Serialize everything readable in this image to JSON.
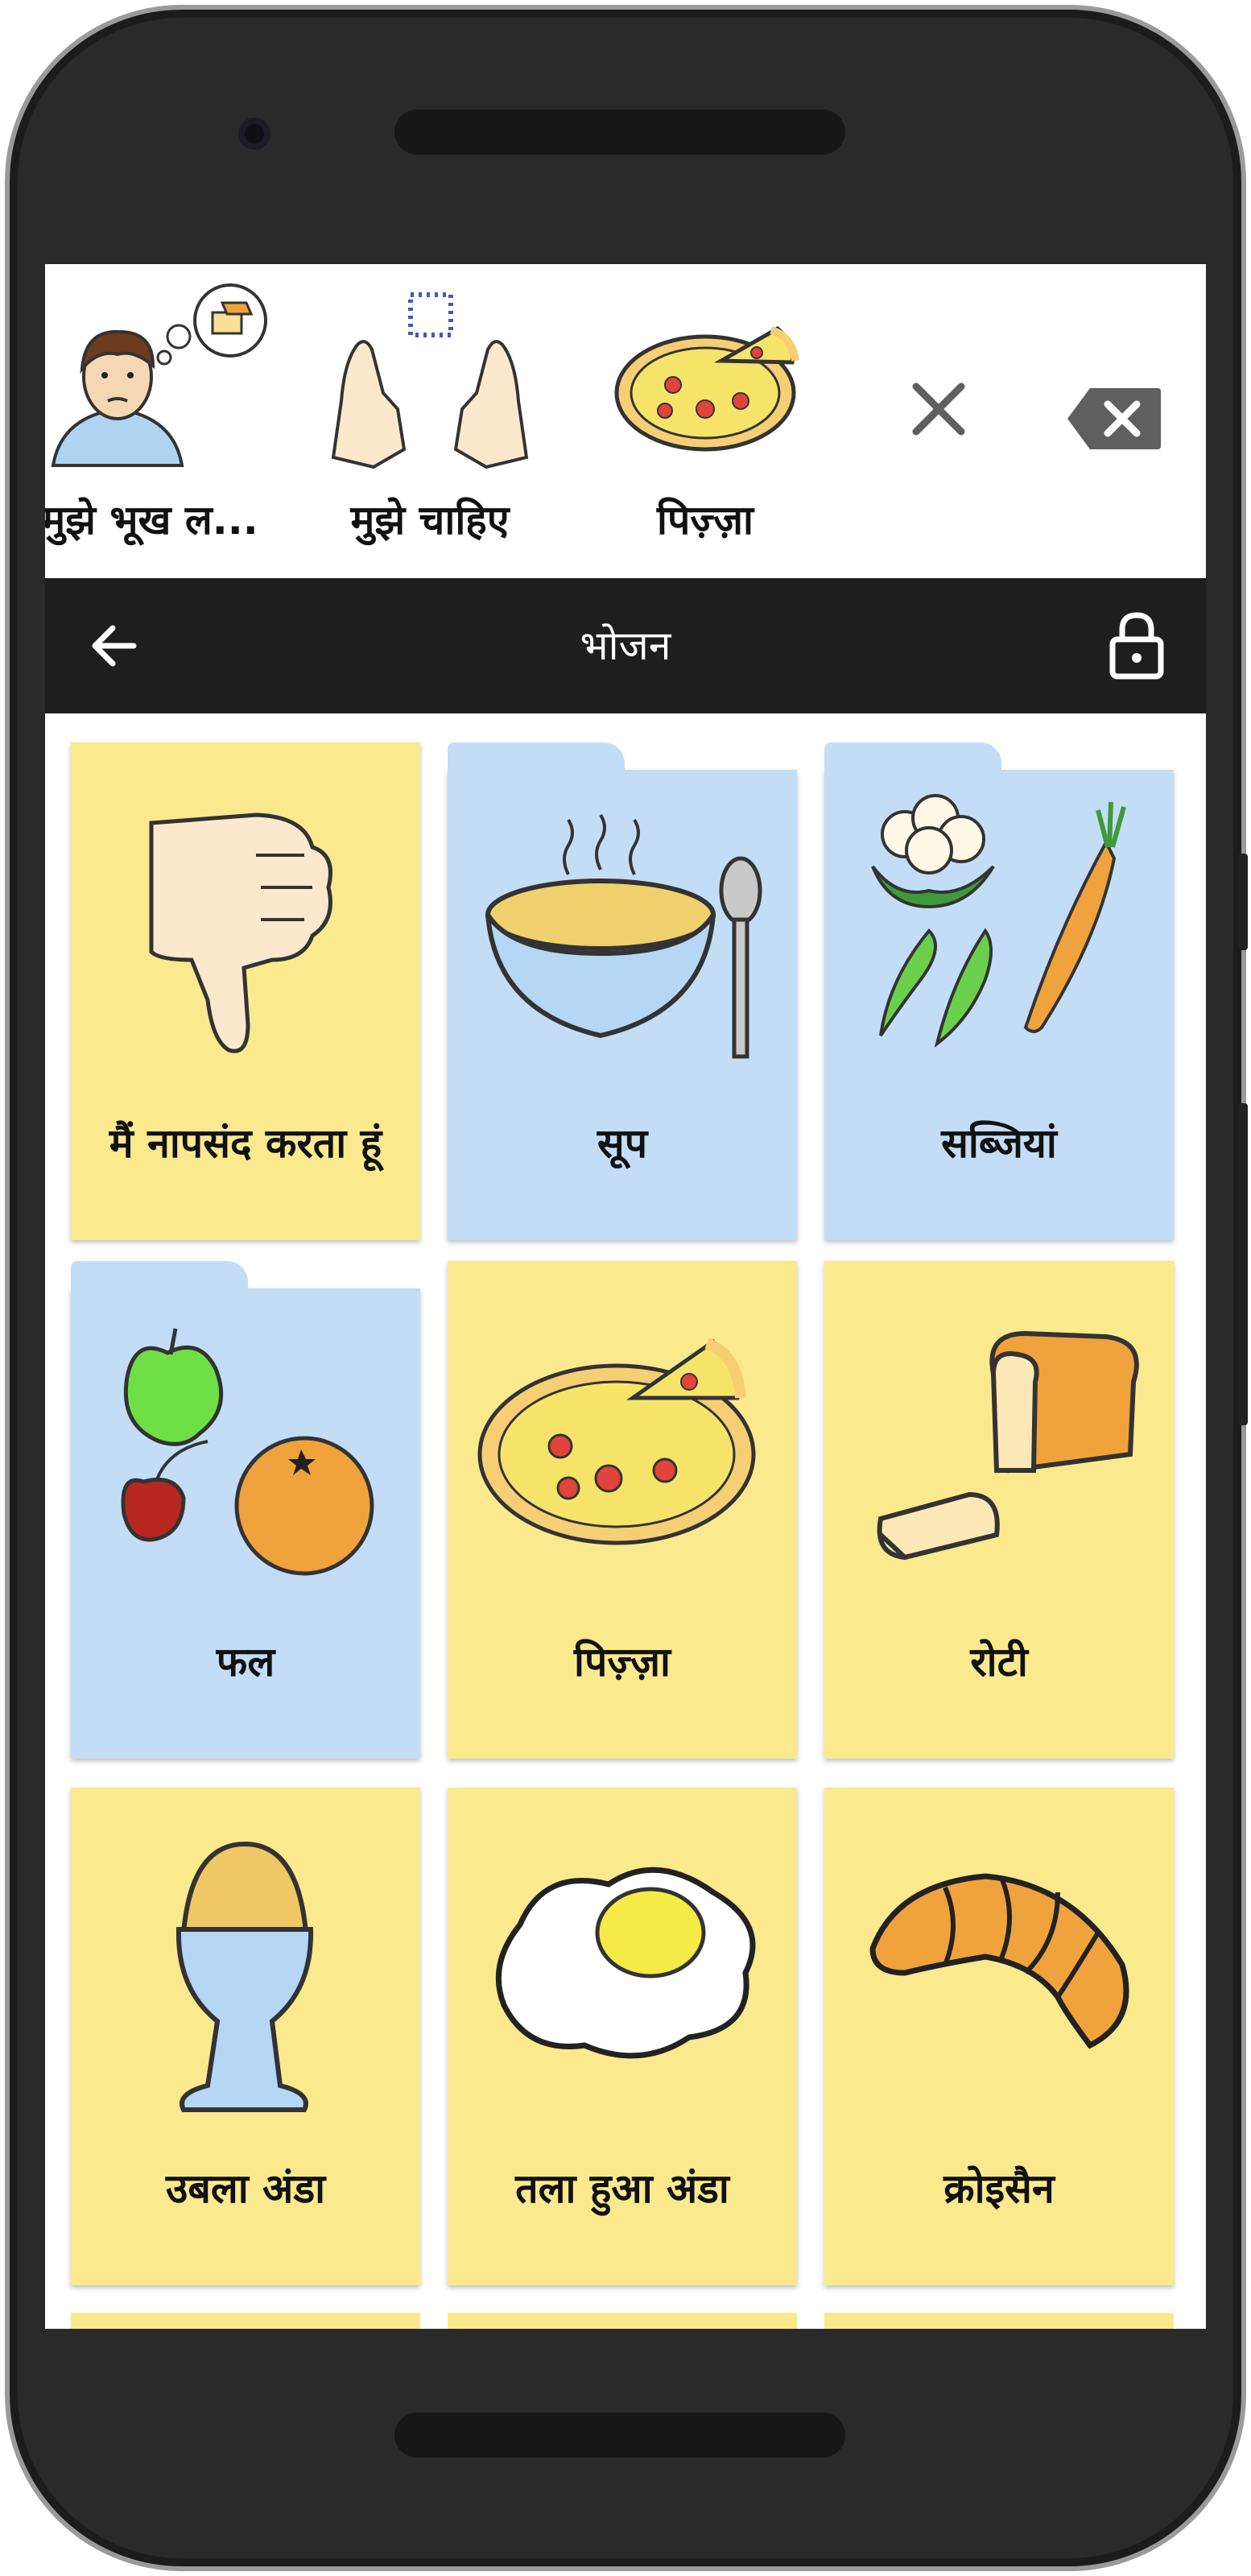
{
  "message_bar": {
    "items": [
      {
        "label": "मुझे भूख ल...",
        "icon": "hungry-person-icon"
      },
      {
        "label": "मुझे चाहिए",
        "icon": "want-hands-icon"
      },
      {
        "label": "पिज़्ज़ा",
        "icon": "pizza-icon"
      }
    ],
    "clear_icon": "close-icon",
    "backspace_icon": "backspace-icon"
  },
  "navbar": {
    "title": "भोजन",
    "back_icon": "arrow-back-icon",
    "lock_icon": "lock-icon"
  },
  "tiles": [
    {
      "label": "मैं नापसंद करता हूं",
      "icon": "thumbs-down-icon",
      "type": "button",
      "color": "#fbe98d"
    },
    {
      "label": "सूप",
      "icon": "soup-bowl-icon",
      "type": "folder",
      "color": "#c3ddf6"
    },
    {
      "label": "सब्जियां",
      "icon": "vegetables-icon",
      "type": "folder",
      "color": "#c3ddf6"
    },
    {
      "label": "फल",
      "icon": "fruits-icon",
      "type": "folder",
      "color": "#c3ddf6"
    },
    {
      "label": "पिज़्ज़ा",
      "icon": "pizza-icon",
      "type": "button",
      "color": "#fbe98d"
    },
    {
      "label": "रोटी",
      "icon": "bread-icon",
      "type": "button",
      "color": "#fbe98d"
    },
    {
      "label": "उबला अंडा",
      "icon": "boiled-egg-icon",
      "type": "button",
      "color": "#fbe98d"
    },
    {
      "label": "तला हुआ अंडा",
      "icon": "fried-egg-icon",
      "type": "button",
      "color": "#fbe98d"
    },
    {
      "label": "क्रोइसैन",
      "icon": "croissant-icon",
      "type": "button",
      "color": "#fbe98d"
    }
  ],
  "colors": {
    "navbar_bg": "#1e1e1e",
    "button_tile": "#fbe98d",
    "folder_tile": "#c3ddf6",
    "phone_body": "#2a2a2a"
  }
}
